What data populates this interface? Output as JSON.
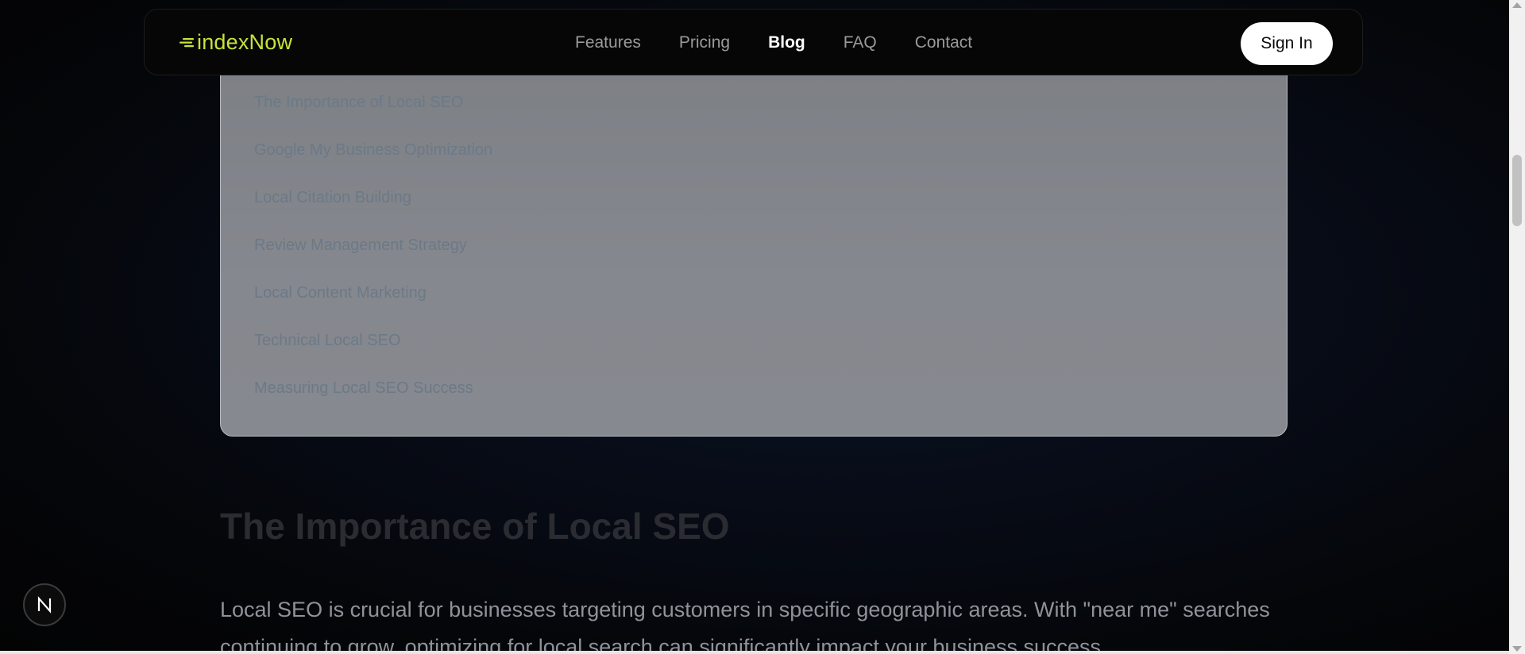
{
  "brand": {
    "name": "indexNow",
    "accent": "#c7e338"
  },
  "nav": {
    "links": [
      "Features",
      "Pricing",
      "Blog",
      "FAQ",
      "Contact"
    ],
    "active": "Blog",
    "signin_label": "Sign In"
  },
  "toc": {
    "items": [
      "The Importance of Local SEO",
      "Google My Business Optimization",
      "Local Citation Building",
      "Review Management Strategy",
      "Local Content Marketing",
      "Technical Local SEO",
      "Measuring Local SEO Success"
    ]
  },
  "article": {
    "heading": "The Importance of Local SEO",
    "paragraph": "Local SEO is crucial for businesses targeting customers in specific geographic areas. With \"near me\" searches continuing to grow, optimizing for local search can significantly impact your business success."
  },
  "badge": {
    "letter": "N",
    "icon": "nextjs-logo-icon"
  },
  "colors": {
    "background": "#050608",
    "card": "#818489",
    "toc_link": "#6c7987"
  }
}
